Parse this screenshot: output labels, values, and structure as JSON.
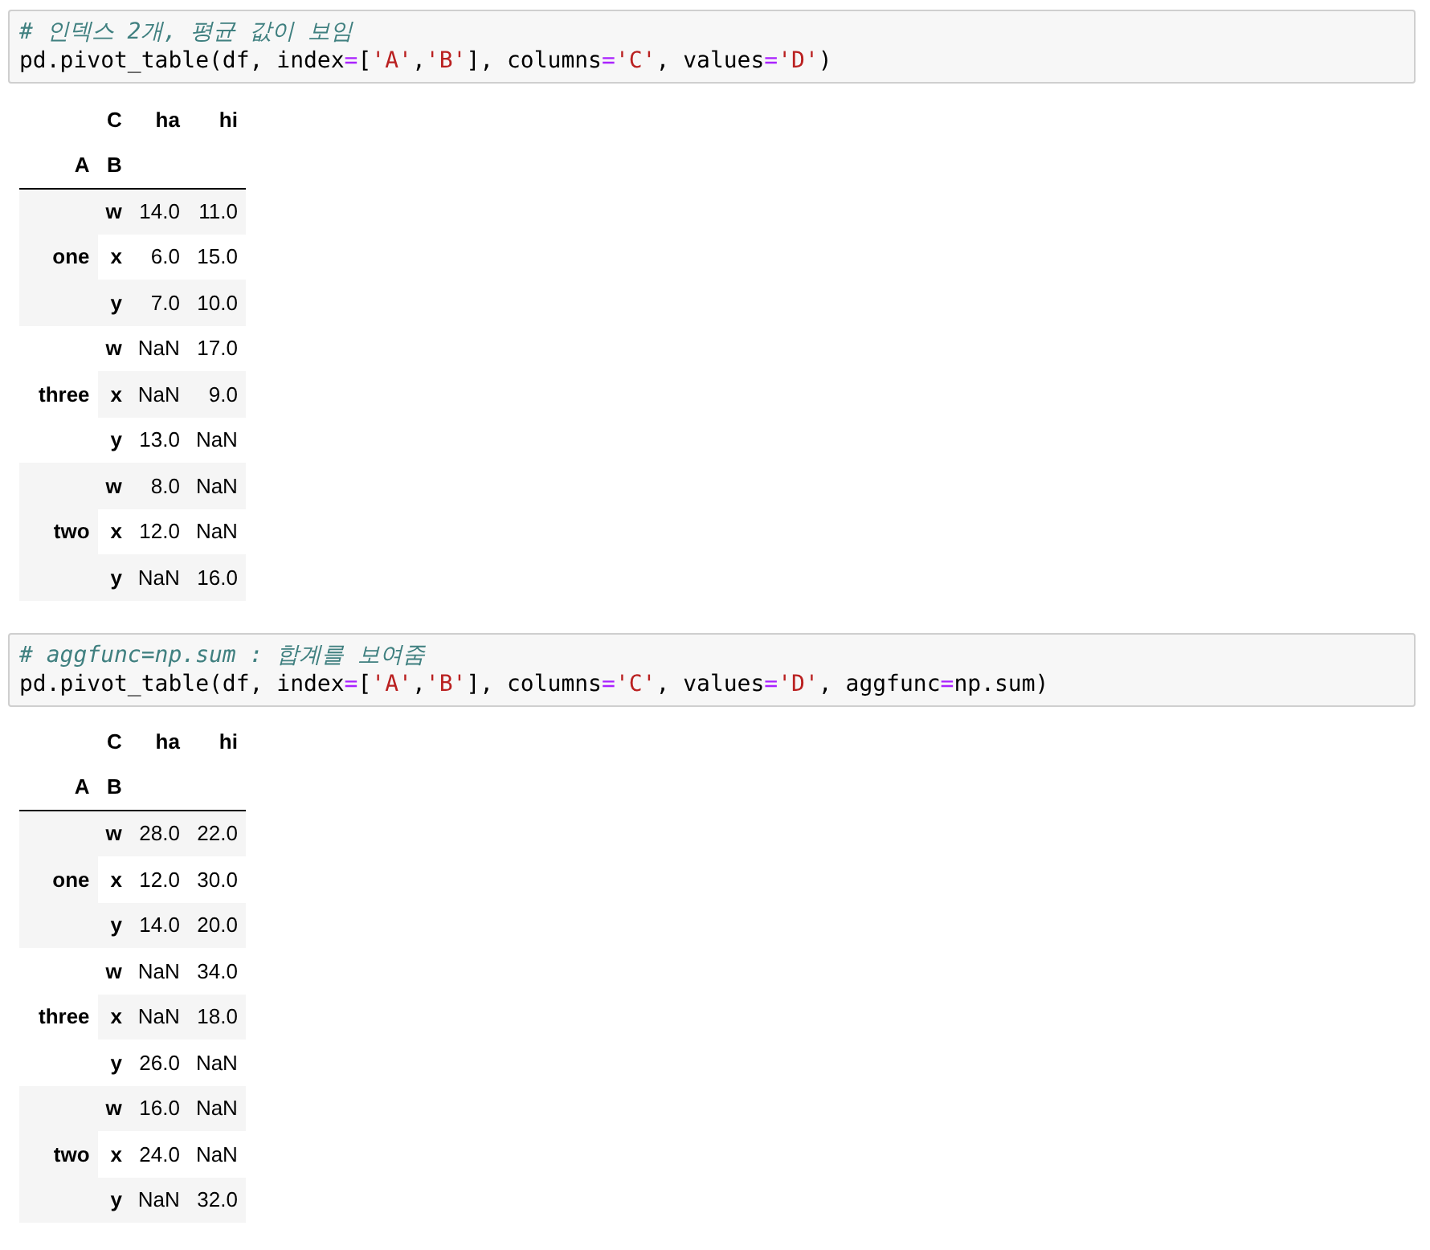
{
  "cells": [
    {
      "code": [
        [
          {
            "kind": "comment",
            "text": "# 인덱스 2개, 평균 값이 보임"
          }
        ],
        [
          {
            "kind": "plain",
            "text": "pd.pivot_table(df, index"
          },
          {
            "kind": "operator",
            "text": "="
          },
          {
            "kind": "plain",
            "text": "["
          },
          {
            "kind": "string",
            "text": "'A'"
          },
          {
            "kind": "plain",
            "text": ","
          },
          {
            "kind": "string",
            "text": "'B'"
          },
          {
            "kind": "plain",
            "text": "], columns"
          },
          {
            "kind": "operator",
            "text": "="
          },
          {
            "kind": "string",
            "text": "'C'"
          },
          {
            "kind": "plain",
            "text": ", values"
          },
          {
            "kind": "operator",
            "text": "="
          },
          {
            "kind": "string",
            "text": "'D'"
          },
          {
            "kind": "plain",
            "text": ")"
          }
        ]
      ],
      "output": {
        "columns_name": "C",
        "columns": [
          "ha",
          "hi"
        ],
        "index_names": [
          "A",
          "B"
        ],
        "groups": [
          {
            "label": "one",
            "rows": [
              {
                "key": "w",
                "values": [
                  "14.0",
                  "11.0"
                ]
              },
              {
                "key": "x",
                "values": [
                  "6.0",
                  "15.0"
                ]
              },
              {
                "key": "y",
                "values": [
                  "7.0",
                  "10.0"
                ]
              }
            ]
          },
          {
            "label": "three",
            "rows": [
              {
                "key": "w",
                "values": [
                  "NaN",
                  "17.0"
                ]
              },
              {
                "key": "x",
                "values": [
                  "NaN",
                  "9.0"
                ]
              },
              {
                "key": "y",
                "values": [
                  "13.0",
                  "NaN"
                ]
              }
            ]
          },
          {
            "label": "two",
            "rows": [
              {
                "key": "w",
                "values": [
                  "8.0",
                  "NaN"
                ]
              },
              {
                "key": "x",
                "values": [
                  "12.0",
                  "NaN"
                ]
              },
              {
                "key": "y",
                "values": [
                  "NaN",
                  "16.0"
                ]
              }
            ]
          }
        ]
      }
    },
    {
      "code": [
        [
          {
            "kind": "comment",
            "text": "# aggfunc=np.sum : 합계를 보여줌"
          }
        ],
        [
          {
            "kind": "plain",
            "text": "pd.pivot_table(df, index"
          },
          {
            "kind": "operator",
            "text": "="
          },
          {
            "kind": "plain",
            "text": "["
          },
          {
            "kind": "string",
            "text": "'A'"
          },
          {
            "kind": "plain",
            "text": ","
          },
          {
            "kind": "string",
            "text": "'B'"
          },
          {
            "kind": "plain",
            "text": "], columns"
          },
          {
            "kind": "operator",
            "text": "="
          },
          {
            "kind": "string",
            "text": "'C'"
          },
          {
            "kind": "plain",
            "text": ", values"
          },
          {
            "kind": "operator",
            "text": "="
          },
          {
            "kind": "string",
            "text": "'D'"
          },
          {
            "kind": "plain",
            "text": ", aggfunc"
          },
          {
            "kind": "operator",
            "text": "="
          },
          {
            "kind": "plain",
            "text": "np.sum)"
          }
        ]
      ],
      "output": {
        "columns_name": "C",
        "columns": [
          "ha",
          "hi"
        ],
        "index_names": [
          "A",
          "B"
        ],
        "groups": [
          {
            "label": "one",
            "rows": [
              {
                "key": "w",
                "values": [
                  "28.0",
                  "22.0"
                ]
              },
              {
                "key": "x",
                "values": [
                  "12.0",
                  "30.0"
                ]
              },
              {
                "key": "y",
                "values": [
                  "14.0",
                  "20.0"
                ]
              }
            ]
          },
          {
            "label": "three",
            "rows": [
              {
                "key": "w",
                "values": [
                  "NaN",
                  "34.0"
                ]
              },
              {
                "key": "x",
                "values": [
                  "NaN",
                  "18.0"
                ]
              },
              {
                "key": "y",
                "values": [
                  "26.0",
                  "NaN"
                ]
              }
            ]
          },
          {
            "label": "two",
            "rows": [
              {
                "key": "w",
                "values": [
                  "16.0",
                  "NaN"
                ]
              },
              {
                "key": "x",
                "values": [
                  "24.0",
                  "NaN"
                ]
              },
              {
                "key": "y",
                "values": [
                  "NaN",
                  "32.0"
                ]
              }
            ]
          }
        ]
      }
    }
  ]
}
